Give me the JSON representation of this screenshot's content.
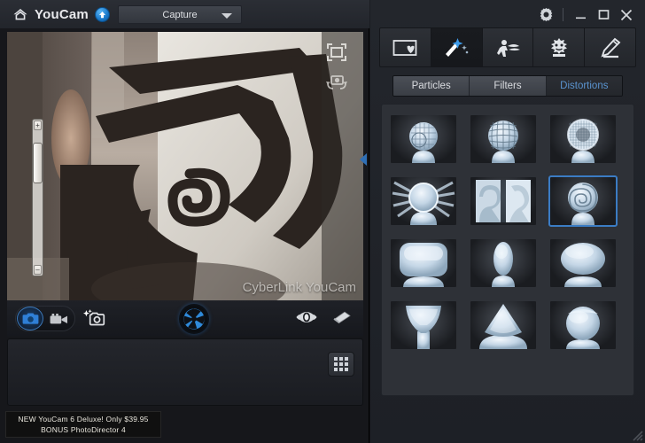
{
  "window": {
    "app_title": "YouCam",
    "home_icon": "home-icon",
    "upgrade_badge_icon": "upgrade-arrow-icon",
    "gear_icon": "gear-icon",
    "minimize_icon": "minimize-icon",
    "maximize_icon": "maximize-icon",
    "close_icon": "close-icon"
  },
  "toolbar": {
    "capture_label": "Capture",
    "capture_caret_icon": "chevron-down-icon"
  },
  "preview": {
    "watermark": "CyberLink YouCam",
    "fullscreen_icon": "fullscreen-icon",
    "rotate_camera_icon": "rotate-camera-icon",
    "zoom_plus": "+",
    "zoom_minus": "–",
    "collapse_icon": "chevron-left-icon"
  },
  "capture_bar": {
    "photo_mode_icon": "camera-icon",
    "video_mode_icon": "video-camera-icon",
    "burst_icon": "burst-capture-icon",
    "shutter_icon": "shutter-aperture-icon",
    "preview_eye_icon": "eye-icon",
    "eraser_icon": "eraser-icon"
  },
  "gallery": {
    "grid_view_icon": "grid-view-icon"
  },
  "promo": {
    "line1": "NEW YouCam 6 Deluxe! Only $39.95",
    "line2": "BONUS PhotoDirector 4"
  },
  "effect_tabs": [
    {
      "name": "frames",
      "icon": "frame-heart-icon",
      "active": false
    },
    {
      "name": "effects",
      "icon": "magic-wand-icon",
      "active": true
    },
    {
      "name": "avatars",
      "icon": "avatar-person-icon",
      "active": false
    },
    {
      "name": "scenes",
      "icon": "scene-face-icon",
      "active": false
    },
    {
      "name": "draw",
      "icon": "pencil-icon",
      "active": false
    }
  ],
  "category_tabs": [
    {
      "label": "Particles",
      "active": false
    },
    {
      "label": "Filters",
      "active": false
    },
    {
      "label": "Distortions",
      "active": true
    }
  ],
  "effects": [
    {
      "name": "mesh-sphere",
      "selected": false
    },
    {
      "name": "grid-bulge",
      "selected": false
    },
    {
      "name": "fine-mesh-glow",
      "selected": false
    },
    {
      "name": "starburst",
      "selected": false
    },
    {
      "name": "split-mirror",
      "selected": false
    },
    {
      "name": "swirl-twirl",
      "selected": true
    },
    {
      "name": "wide-flatten",
      "selected": false
    },
    {
      "name": "narrow-squeeze",
      "selected": false
    },
    {
      "name": "wide-stretch",
      "selected": false
    },
    {
      "name": "funnel",
      "selected": false
    },
    {
      "name": "cone-head",
      "selected": false
    },
    {
      "name": "bulge-sphere",
      "selected": false
    }
  ],
  "colors": {
    "accent_blue": "#3b7cc4",
    "tab_active_text": "#5a93cf",
    "panel_bg": "#2e3137",
    "titlebar_bg": "#2b2e35"
  }
}
